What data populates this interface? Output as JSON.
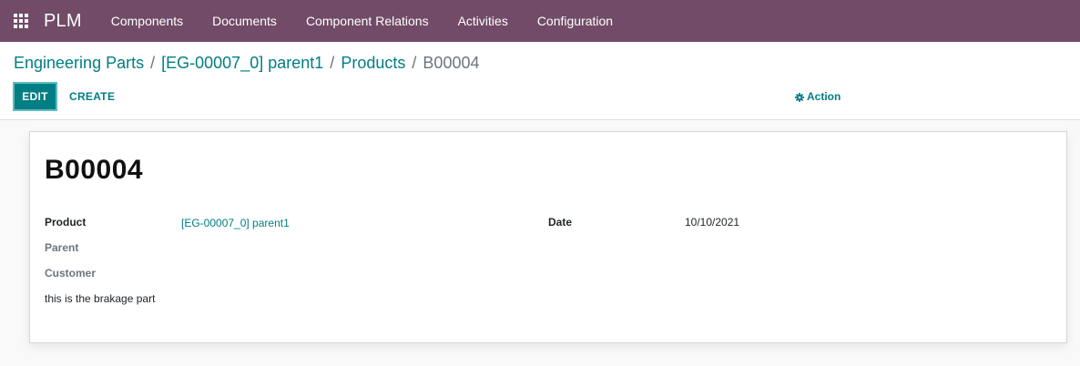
{
  "navbar": {
    "brand": "PLM",
    "menu": [
      "Components",
      "Documents",
      "Component Relations",
      "Activities",
      "Configuration"
    ],
    "bg_color": "#714b67"
  },
  "breadcrumb": {
    "items": [
      "Engineering Parts",
      "[EG-00007_0] parent1",
      "Products"
    ],
    "separator": "/",
    "current": "B00004"
  },
  "toolbar": {
    "edit_label": "EDIT",
    "create_label": "CREATE",
    "action_label": "Action",
    "accent_color": "#017e84"
  },
  "record": {
    "title": "B00004",
    "fields": {
      "product_label": "Product",
      "product_value": "[EG-00007_0] parent1",
      "parent_label": "Parent",
      "customer_label": "Customer",
      "date_label": "Date",
      "date_value": "10/10/2021"
    },
    "note": "this is the brakage part"
  }
}
